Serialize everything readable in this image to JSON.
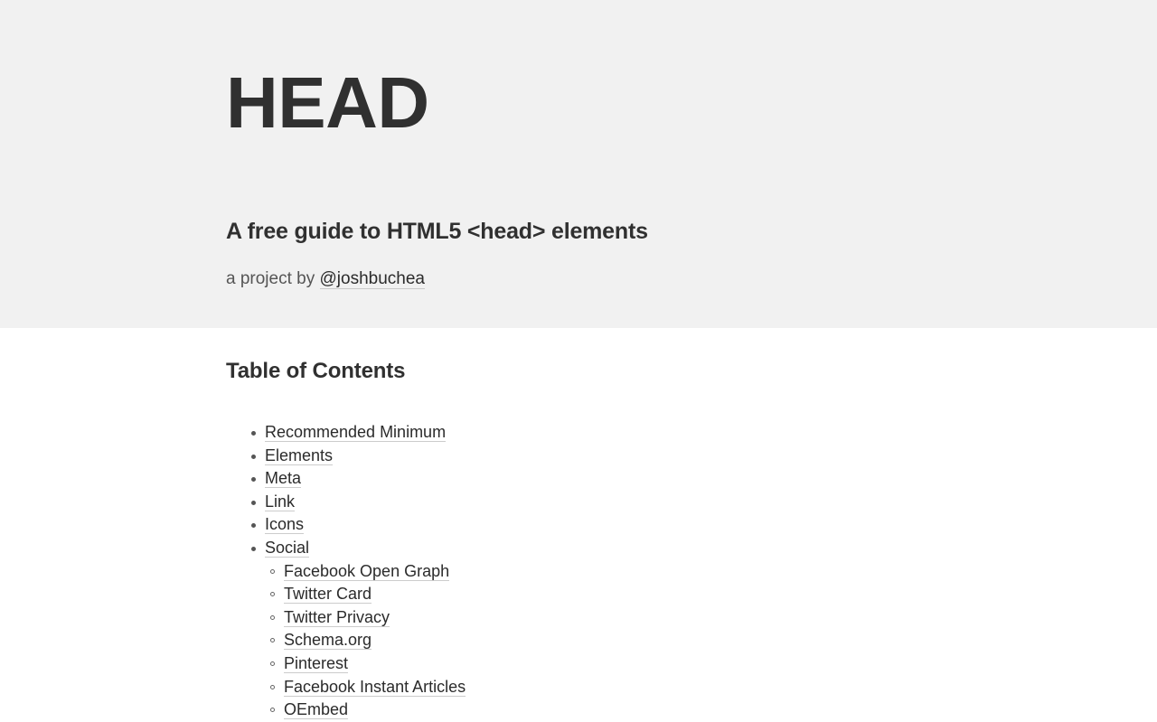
{
  "header": {
    "title": "HEAD",
    "tagline": "A free guide to HTML5 <head> elements",
    "byline_prefix": "a project by ",
    "byline_link": "@joshbuchea",
    "background_color": "#f1f1f1",
    "text_color": "#303030"
  },
  "main": {
    "toc_heading": "Table of Contents",
    "toc": [
      {
        "label": "Recommended Minimum",
        "children": []
      },
      {
        "label": "Elements",
        "children": []
      },
      {
        "label": "Meta",
        "children": []
      },
      {
        "label": "Link",
        "children": []
      },
      {
        "label": "Icons",
        "children": []
      },
      {
        "label": "Social",
        "children": [
          {
            "label": "Facebook Open Graph"
          },
          {
            "label": "Twitter Card"
          },
          {
            "label": "Twitter Privacy"
          },
          {
            "label": "Schema.org"
          },
          {
            "label": "Pinterest"
          },
          {
            "label": "Facebook Instant Articles"
          },
          {
            "label": "OEmbed"
          }
        ]
      }
    ],
    "link_color": "#2b2b2b",
    "link_underline_color": "#cccccc"
  }
}
